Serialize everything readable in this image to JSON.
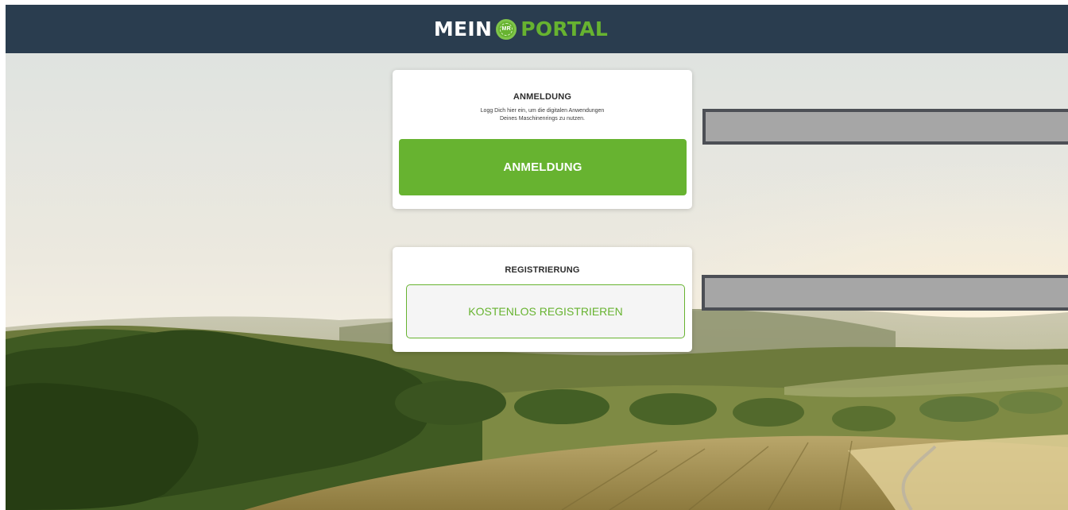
{
  "header": {
    "logo_part1": "MEIN",
    "logo_badge": "MR",
    "logo_part2": "PORTAL",
    "background": "#2a3d4f",
    "accent": "#67b330"
  },
  "login_card": {
    "title": "ANMELDUNG",
    "description_line1": "Logg Dich hier ein, um die digitalen Anwendungen",
    "description_line2": "Deines Maschinenrings zu nutzen.",
    "button_label": "ANMELDUNG"
  },
  "register_card": {
    "title": "REGISTRIERUNG",
    "button_label": "KOSTENLOS REGISTRIEREN"
  },
  "background_image": {
    "icon": "landscape-photo"
  }
}
